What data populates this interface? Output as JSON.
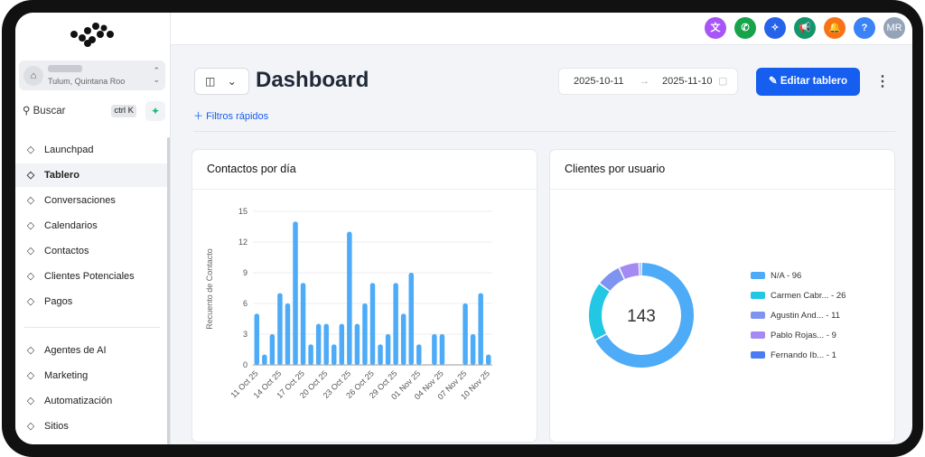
{
  "sidebar": {
    "account_location": "Tulum, Quintana Roo",
    "search_label": "Buscar",
    "search_shortcut": "ctrl K",
    "items": [
      {
        "label": "Launchpad",
        "icon": "rocket-icon"
      },
      {
        "label": "Tablero",
        "icon": "dashboard-icon"
      },
      {
        "label": "Conversaciones",
        "icon": "chat-icon"
      },
      {
        "label": "Calendarios",
        "icon": "calendar-icon"
      },
      {
        "label": "Contactos",
        "icon": "contacts-icon"
      },
      {
        "label": "Clientes Potenciales",
        "icon": "leads-icon"
      },
      {
        "label": "Pagos",
        "icon": "payments-icon"
      }
    ],
    "items2": [
      {
        "label": "Agentes de AI",
        "icon": "sparkle-icon"
      },
      {
        "label": "Marketing",
        "icon": "send-icon"
      },
      {
        "label": "Automatización",
        "icon": "automation-icon"
      },
      {
        "label": "Sitios",
        "icon": "sites-icon"
      }
    ]
  },
  "topbar": {
    "avatar": "MR",
    "colors": {
      "translate": "#a855f7",
      "phone": "#16a34a",
      "magic": "#2563eb",
      "announce": "#14966b",
      "bell": "#f97316",
      "help": "#3b82f6",
      "avatar": "#94a3b8"
    }
  },
  "header": {
    "title": "Dashboard",
    "date_from": "2025-10-11",
    "date_to": "2025-11-10",
    "edit_label": "Editar tablero",
    "filters_label": "Filtros rápidos"
  },
  "chart_data": [
    {
      "type": "bar",
      "title": "Contactos por día",
      "ylabel": "Recuento de Contacto",
      "ylim": [
        0,
        15
      ],
      "yticks": [
        "0",
        "3",
        "6",
        "9",
        "12",
        "15"
      ],
      "tick_labels": [
        "11 Oct 25",
        "14 Oct 25",
        "17 Oct 25",
        "20 Oct 25",
        "23 Oct 25",
        "26 Oct 25",
        "29 Oct 25",
        "01 Nov 25",
        "04 Nov 25",
        "07 Nov 25",
        "10 Nov 25"
      ],
      "values": [
        5,
        1,
        3,
        7,
        6,
        14,
        8,
        2,
        4,
        4,
        2,
        4,
        13,
        4,
        6,
        8,
        2,
        3,
        8,
        5,
        9,
        2,
        0,
        3,
        3,
        0,
        0,
        6,
        3,
        7,
        1
      ],
      "color": "#4dabf7"
    },
    {
      "type": "pie",
      "title": "Clientes por usuario",
      "total": "143",
      "slices": [
        {
          "label": "N/A - 96",
          "value": 96,
          "color": "#4dabf7"
        },
        {
          "label": "Carmen Cabr... - 26",
          "value": 26,
          "color": "#22c7e3"
        },
        {
          "label": "Agustin And... - 11",
          "value": 11,
          "color": "#7f93f1"
        },
        {
          "label": "Pablo Rojas... - 9",
          "value": 9,
          "color": "#a48af2"
        },
        {
          "label": "Fernando Ib... - 1",
          "value": 1,
          "color": "#4b7cf3"
        }
      ]
    }
  ]
}
